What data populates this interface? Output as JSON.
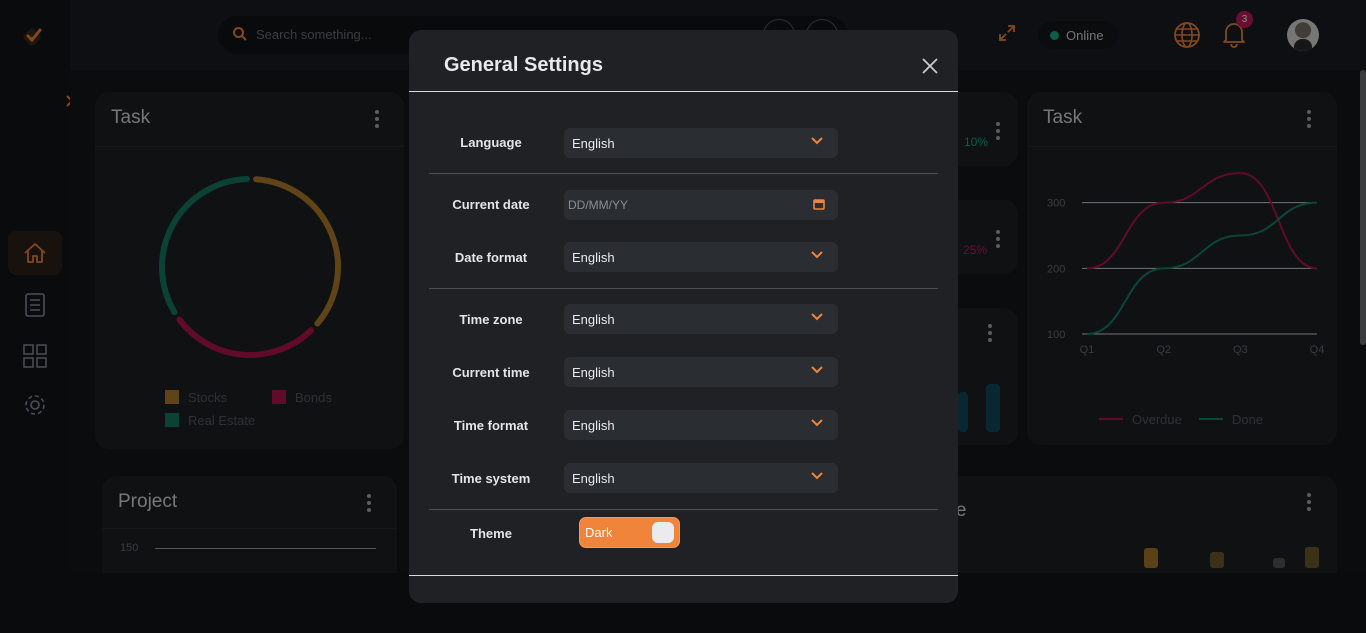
{
  "topbar": {
    "search_placeholder": "Search something...",
    "status": "Online",
    "notification_count": "3"
  },
  "cards": {
    "task_left": {
      "title": "Task",
      "legend": [
        "Stocks",
        "Bonds",
        "Real Estate"
      ]
    },
    "task_right": {
      "title": "Task",
      "legend": [
        "Overdue",
        "Done"
      ]
    },
    "project": {
      "title": "Project",
      "y_tick": "150"
    },
    "mid_stat_1": "10%",
    "mid_stat_2": "25%",
    "time_card_title_fragment": "me"
  },
  "chart_data": [
    {
      "type": "pie",
      "title": "Task",
      "labels": [
        "Stocks",
        "Bonds",
        "Real Estate"
      ],
      "values": [
        35,
        27,
        33
      ],
      "colors": [
        "#b07d2a",
        "#b0164a",
        "#137a63"
      ]
    },
    {
      "type": "line",
      "title": "Task",
      "categories": [
        "Q1",
        "Q2",
        "Q3",
        "Q4"
      ],
      "ylim": [
        100,
        400
      ],
      "yticks": [
        100,
        200,
        300,
        400
      ],
      "grid": true,
      "legend_position": "bottom",
      "series": [
        {
          "name": "Overdue",
          "values": [
            200,
            300,
            345,
            200
          ],
          "color": "#b0164a"
        },
        {
          "name": "Done",
          "values": [
            100,
            200,
            250,
            300
          ],
          "color": "#13806a"
        }
      ]
    }
  ],
  "modal": {
    "title": "General Settings",
    "fields": {
      "language": {
        "label": "Language",
        "value": "English"
      },
      "current_date": {
        "label": "Current date",
        "placeholder": "DD/MM/YY"
      },
      "date_format": {
        "label": "Date format",
        "value": "English"
      },
      "time_zone": {
        "label": "Time zone",
        "value": "English"
      },
      "current_time": {
        "label": "Current time",
        "value": "English"
      },
      "time_format": {
        "label": "Time format",
        "value": "English"
      },
      "time_system": {
        "label": "Time system",
        "value": "English"
      },
      "theme": {
        "label": "Theme",
        "value": "Dark"
      }
    }
  },
  "colors": {
    "accent": "#f0843a",
    "online": "#17a884",
    "badge": "#c2185b"
  }
}
